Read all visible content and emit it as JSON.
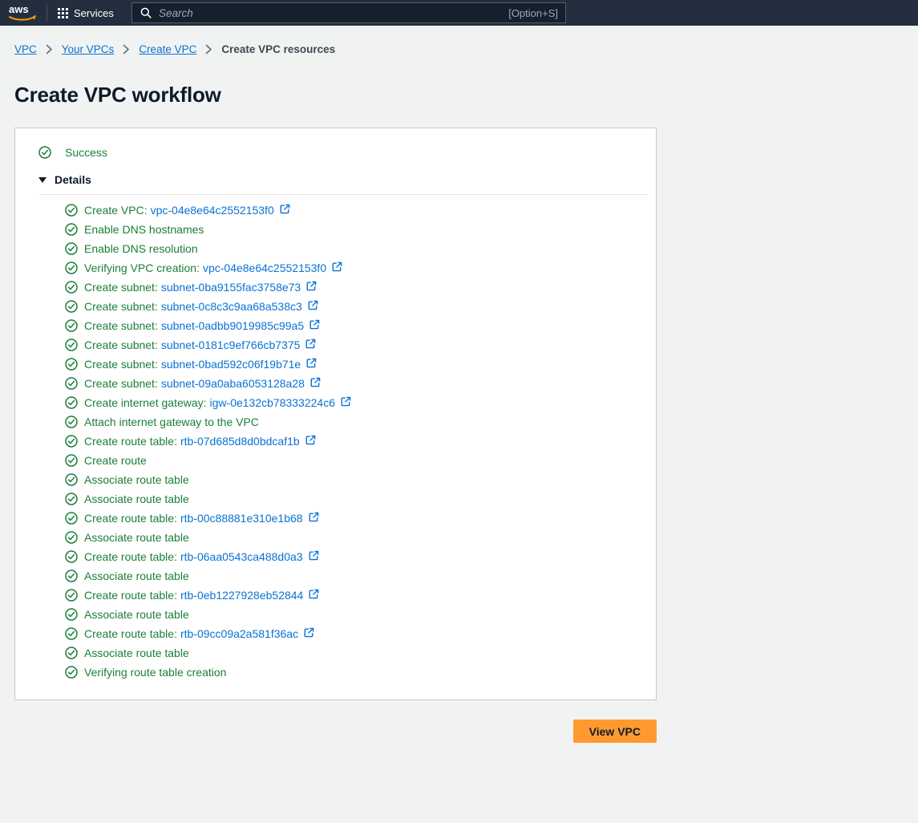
{
  "topnav": {
    "logo_alt": "aws",
    "services_label": "Services",
    "search_placeholder": "Search",
    "search_value": "",
    "search_hint": "[Option+S]"
  },
  "breadcrumb": {
    "items": [
      {
        "label": "VPC",
        "current": false
      },
      {
        "label": "Your VPCs",
        "current": false
      },
      {
        "label": "Create VPC",
        "current": false
      },
      {
        "label": "Create VPC resources",
        "current": true
      }
    ]
  },
  "page": {
    "title": "Create VPC workflow"
  },
  "card": {
    "status": "Success",
    "details_label": "Details",
    "details": [
      {
        "text": "Create VPC:",
        "resource": "vpc-04e8e64c2552153f0",
        "link": true
      },
      {
        "text": "Enable DNS hostnames",
        "resource": "",
        "link": false
      },
      {
        "text": "Enable DNS resolution",
        "resource": "",
        "link": false
      },
      {
        "text": "Verifying VPC creation:",
        "resource": "vpc-04e8e64c2552153f0",
        "link": true
      },
      {
        "text": "Create subnet:",
        "resource": "subnet-0ba9155fac3758e73",
        "link": true
      },
      {
        "text": "Create subnet:",
        "resource": "subnet-0c8c3c9aa68a538c3",
        "link": true
      },
      {
        "text": "Create subnet:",
        "resource": "subnet-0adbb9019985c99a5",
        "link": true
      },
      {
        "text": "Create subnet:",
        "resource": "subnet-0181c9ef766cb7375",
        "link": true
      },
      {
        "text": "Create subnet:",
        "resource": "subnet-0bad592c06f19b71e",
        "link": true
      },
      {
        "text": "Create subnet:",
        "resource": "subnet-09a0aba6053128a28",
        "link": true
      },
      {
        "text": "Create internet gateway:",
        "resource": "igw-0e132cb78333224c6",
        "link": true
      },
      {
        "text": "Attach internet gateway to the VPC",
        "resource": "",
        "link": false
      },
      {
        "text": "Create route table:",
        "resource": "rtb-07d685d8d0bdcaf1b",
        "link": true
      },
      {
        "text": "Create route",
        "resource": "",
        "link": false
      },
      {
        "text": "Associate route table",
        "resource": "",
        "link": false
      },
      {
        "text": "Associate route table",
        "resource": "",
        "link": false
      },
      {
        "text": "Create route table:",
        "resource": "rtb-00c88881e310e1b68",
        "link": true
      },
      {
        "text": "Associate route table",
        "resource": "",
        "link": false
      },
      {
        "text": "Create route table:",
        "resource": "rtb-06aa0543ca488d0a3",
        "link": true
      },
      {
        "text": "Associate route table",
        "resource": "",
        "link": false
      },
      {
        "text": "Create route table:",
        "resource": "rtb-0eb1227928eb52844",
        "link": true
      },
      {
        "text": "Associate route table",
        "resource": "",
        "link": false
      },
      {
        "text": "Create route table:",
        "resource": "rtb-09cc09a2a581f36ac",
        "link": true
      },
      {
        "text": "Associate route table",
        "resource": "",
        "link": false
      },
      {
        "text": "Verifying route table creation",
        "resource": "",
        "link": false
      }
    ]
  },
  "actions": {
    "view_vpc_label": "View VPC"
  },
  "colors": {
    "nav_background": "#232f3e",
    "page_background": "#f1f3f3",
    "success_green": "#1a7f37",
    "link_blue": "#0972d3",
    "primary_button": "#ff9a30",
    "card_border": "#c6c6cd"
  }
}
